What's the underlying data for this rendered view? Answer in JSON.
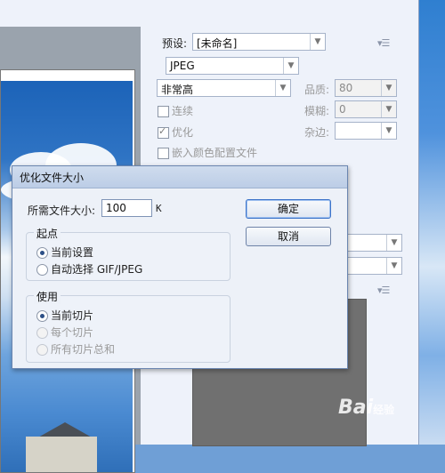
{
  "settings": {
    "preset_label": "预设:",
    "preset_value": "[未命名]",
    "format_value": "JPEG",
    "quality_level_value": "非常高",
    "quality_label": "品质:",
    "quality_value": "80",
    "progressive_label": "连续",
    "blur_label": "模糊:",
    "blur_value": "0",
    "optimized_label": "优化",
    "matte_label": "杂边:",
    "embed_profile_label": "嵌入颜色配置文件"
  },
  "dialog": {
    "title": "优化文件大小",
    "desired_size_label": "所需文件大小:",
    "desired_size_value": "100",
    "size_unit": "K",
    "ok_label": "确定",
    "cancel_label": "取消",
    "start_group": {
      "title": "起点",
      "options": [
        "当前设置",
        "自动选择 GIF/JPEG"
      ],
      "selected": 0
    },
    "use_group": {
      "title": "使用",
      "options": [
        "当前切片",
        "每个切片",
        "所有切片总和"
      ],
      "selected": 0
    }
  },
  "watermark": {
    "text": "Bai",
    "suffix": "经验"
  },
  "icons": {
    "menu": "panel-menu-icon",
    "dropdown": "chevron-down-icon"
  },
  "colors": {
    "dialog_border": "#6b86b0",
    "default_button_border": "#3c73c9",
    "sky": "#2f74c4"
  }
}
